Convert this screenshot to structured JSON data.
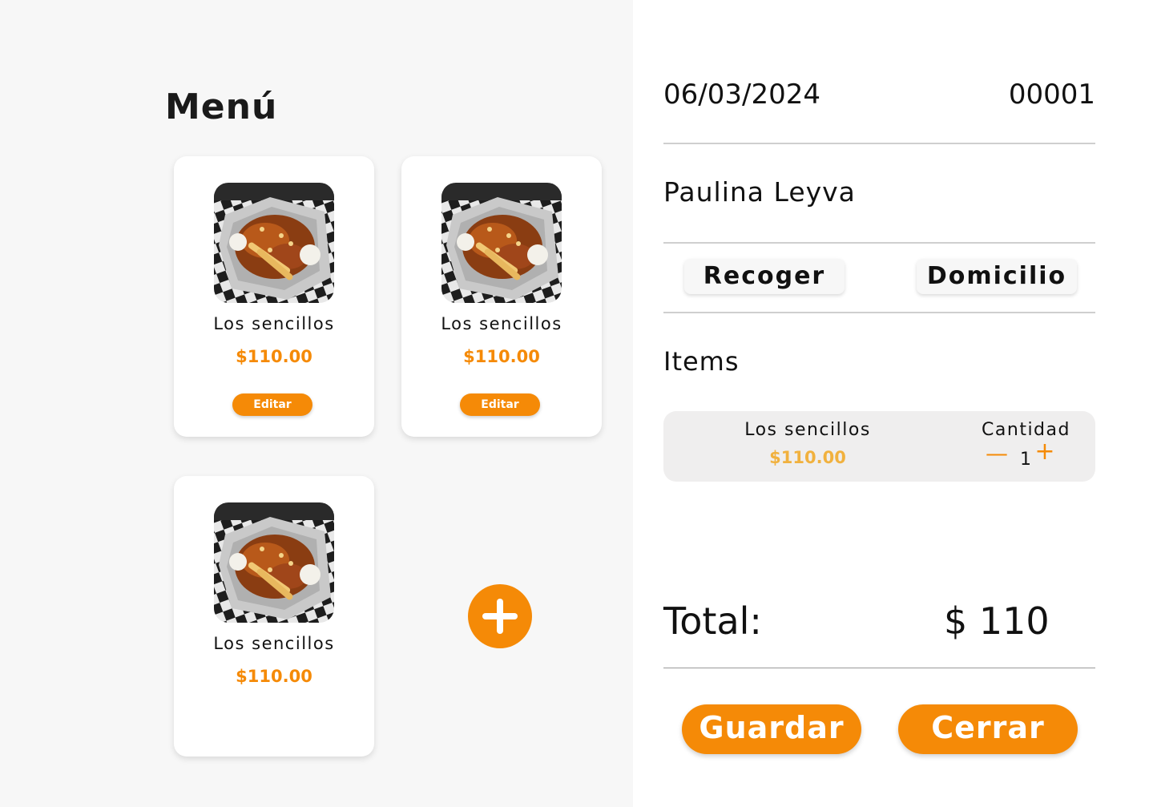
{
  "menu": {
    "title": "Menú",
    "items": [
      {
        "name": "Los sencillos",
        "price": "$110.00",
        "edit_label": "Editar"
      },
      {
        "name": "Los sencillos",
        "price": "$110.00",
        "edit_label": "Editar"
      },
      {
        "name": "Los sencillos",
        "price": "$110.00"
      }
    ],
    "add_icon": "plus-icon",
    "accent_color": "#f58a07"
  },
  "order": {
    "date": "06/03/2024",
    "number": "00001",
    "customer": "Paulina Leyva",
    "modes": [
      "Recoger",
      "Domicilio"
    ],
    "items_title": "Items",
    "items": [
      {
        "name": "Los sencillos",
        "price": "$110.00",
        "qty_label": "Cantidad",
        "qty": "1"
      }
    ],
    "total_label": "Total:",
    "total_value": "$ 110",
    "save_label": "Guardar",
    "close_label": "Cerrar"
  }
}
